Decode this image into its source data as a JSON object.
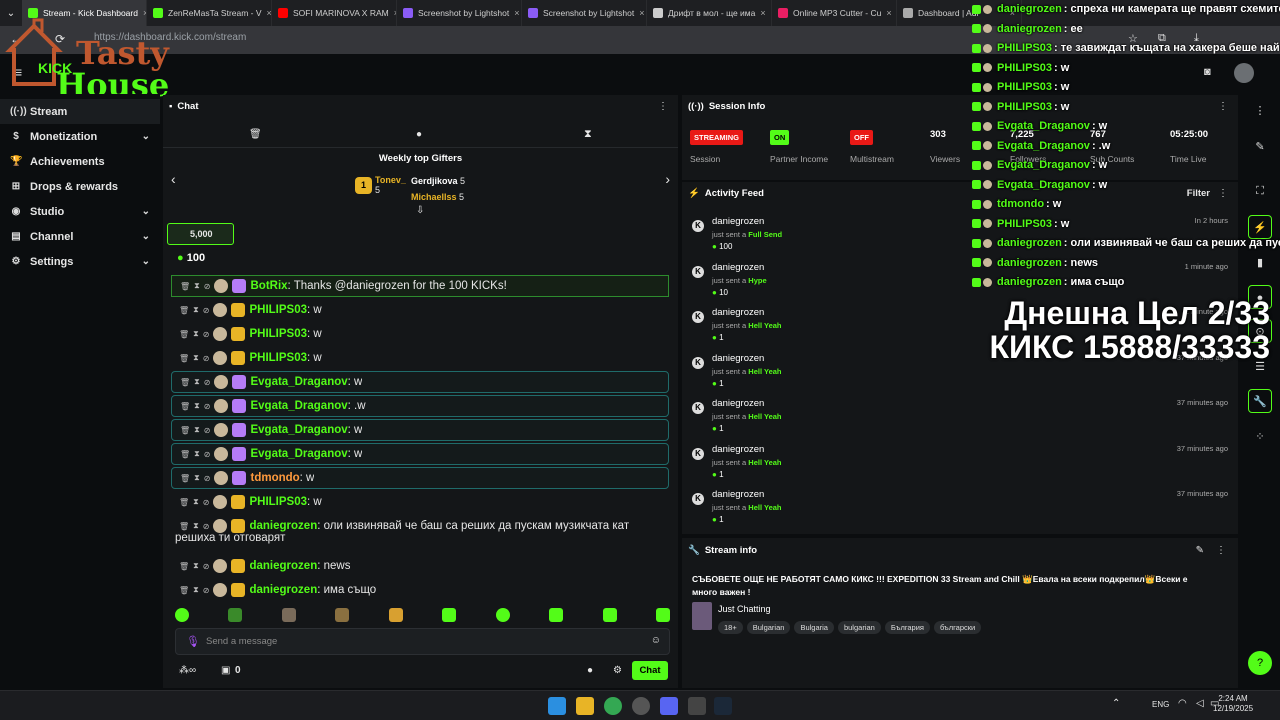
{
  "browser": {
    "tabs": [
      {
        "title": "Stream - Kick Dashboard",
        "color": "#53fc18",
        "active": true
      },
      {
        "title": "ZenReMasTa Stream - V",
        "color": "#53fc18",
        "active": false
      },
      {
        "title": "SOFI MARINOVA X RAM",
        "color": "#ff0000",
        "active": false
      },
      {
        "title": "Screenshot by Lightshot",
        "color": "#8b5cf6",
        "active": false
      },
      {
        "title": "Screenshot by Lightshot",
        "color": "#8b5cf6",
        "active": false
      },
      {
        "title": "Дрифт в мол - ще има",
        "color": "#cccccc",
        "active": false
      },
      {
        "title": "Online MP3 Cutter - Cu",
        "color": "#e91e63",
        "active": false
      },
      {
        "title": "Dashboard | Adi",
        "color": "#aaaaaa",
        "active": false
      }
    ],
    "url": "https://dashboard.kick.com/stream"
  },
  "logo": {
    "line1": "Tasty",
    "line2": "House",
    "brand": "KICK"
  },
  "sidebar": {
    "items": [
      {
        "label": "Stream",
        "icon": "stream-icon",
        "glyph": "((·))",
        "chevron": false,
        "selected": true
      },
      {
        "label": "Monetization",
        "icon": "dollar-icon",
        "glyph": "$",
        "chevron": true,
        "selected": false
      },
      {
        "label": "Achievements",
        "icon": "trophy-icon",
        "glyph": "🏆",
        "chevron": false,
        "selected": false
      },
      {
        "label": "Drops & rewards",
        "icon": "gift-icon",
        "glyph": "⊞",
        "chevron": false,
        "selected": false
      },
      {
        "label": "Studio",
        "icon": "studio-icon",
        "glyph": "◉",
        "chevron": true,
        "selected": false
      },
      {
        "label": "Channel",
        "icon": "channel-icon",
        "glyph": "▤",
        "chevron": true,
        "selected": false
      },
      {
        "label": "Settings",
        "icon": "gear-icon",
        "glyph": "⚙",
        "chevron": true,
        "selected": false
      }
    ]
  },
  "chat": {
    "title": "Chat",
    "gifters_title": "Weekly top Gifters",
    "gifters": [
      {
        "name": "Tonev_",
        "count": "5"
      },
      {
        "name": "Gerdjikova",
        "count": "5"
      },
      {
        "name": "Michaellss",
        "count": "5"
      }
    ],
    "pinned_amount": "5,000",
    "pinned_kicks": "100",
    "messages": [
      {
        "user": "BotRix",
        "text": ": Thanks @daniegrozen for the 100 KICKs!",
        "color": "#53fc18",
        "style": "green"
      },
      {
        "user": "PHILIPS03",
        "text": ": w",
        "color": "#53fc18",
        "style": "plain"
      },
      {
        "user": "PHILIPS03",
        "text": ": w",
        "color": "#53fc18",
        "style": "plain"
      },
      {
        "user": "PHILIPS03",
        "text": ": w",
        "color": "#53fc18",
        "style": "plain"
      },
      {
        "user": "Evgata_Draganov",
        "text": ": w",
        "color": "#53fc18",
        "style": "boxed"
      },
      {
        "user": "Evgata_Draganov",
        "text": ": .w",
        "color": "#53fc18",
        "style": "boxed"
      },
      {
        "user": "Evgata_Draganov",
        "text": ": w",
        "color": "#53fc18",
        "style": "boxed"
      },
      {
        "user": "Evgata_Draganov",
        "text": ": w",
        "color": "#53fc18",
        "style": "boxed"
      },
      {
        "user": "tdmondo",
        "text": ": w",
        "color": "#ff9a3d",
        "style": "boxed"
      },
      {
        "user": "PHILIPS03",
        "text": ": w",
        "color": "#53fc18",
        "style": "plain"
      },
      {
        "user": "daniegrozen",
        "text": ": оли извинявай че баш са реших да пускам музикчата кат",
        "color": "#53fc18",
        "style": "plain"
      },
      {
        "user": "daniegrozen",
        "text": ": news",
        "color": "#53fc18",
        "style": "plain"
      },
      {
        "user": "daniegrozen",
        "text": ": има също",
        "color": "#53fc18",
        "style": "plain"
      }
    ],
    "wrap_line": "решиха ти отговарят",
    "input_placeholder": "Send a message",
    "footer_count": "0",
    "send_label": "Chat"
  },
  "session": {
    "title": "Session Info",
    "status": [
      {
        "badge": "STREAMING",
        "label": "Session",
        "color": "#e91916"
      },
      {
        "badge": "ON",
        "label": "Partner Income",
        "color": "#53fc18"
      },
      {
        "badge": "OFF",
        "label": "Multistream",
        "color": "#e91916"
      }
    ],
    "stats": [
      {
        "value": "303",
        "label": "Viewers"
      },
      {
        "value": "7,225",
        "label": "Followers"
      },
      {
        "value": "767",
        "label": "Sub Counts"
      },
      {
        "value": "05:25:00",
        "label": "Time Live"
      }
    ]
  },
  "activity": {
    "title": "Activity Feed",
    "filter": "Filter",
    "items": [
      {
        "user": "daniegrozen",
        "action": "just sent a",
        "item": "Full Send",
        "amount": "100",
        "time": "In 2 hours"
      },
      {
        "user": "daniegrozen",
        "action": "just sent a",
        "item": "Hype",
        "amount": "10",
        "time": "1 minute ago"
      },
      {
        "user": "daniegrozen",
        "action": "just sent a",
        "item": "Hell Yeah",
        "amount": "1",
        "time": "1 minute ago"
      },
      {
        "user": "daniegrozen",
        "action": "just sent a",
        "item": "Hell Yeah",
        "amount": "1",
        "time": "37 minutes ago"
      },
      {
        "user": "daniegrozen",
        "action": "just sent a",
        "item": "Hell Yeah",
        "amount": "1",
        "time": "37 minutes ago"
      },
      {
        "user": "daniegrozen",
        "action": "just sent a",
        "item": "Hell Yeah",
        "amount": "1",
        "time": "37 minutes ago"
      },
      {
        "user": "daniegrozen",
        "action": "just sent a",
        "item": "Hell Yeah",
        "amount": "1",
        "time": "37 minutes ago"
      }
    ]
  },
  "stream_info": {
    "title": "Stream info",
    "stream_title": "СЪБОВЕТЕ ОЩЕ НЕ РАБОТЯТ САМО КИКС !!! EXPEDITION 33 Stream and Chill 👑Евала на всеки подкрепил👑Всеки е много важен !",
    "category": "Just Chatting",
    "tags": [
      "18+",
      "Bulgarian",
      "Bulgaria",
      "bulgarian",
      "България",
      "български"
    ]
  },
  "overlay": {
    "lines": [
      {
        "user": "daniegrozen",
        "text": ": спреха ни камерата ще правят схемите"
      },
      {
        "user": "daniegrozen",
        "text": ": ее"
      },
      {
        "user": "PHILIPS03",
        "text": ": те завиждат къщата на хакера беше най добр"
      },
      {
        "user": "PHILIPS03",
        "text": ": w"
      },
      {
        "user": "PHILIPS03",
        "text": ": w"
      },
      {
        "user": "PHILIPS03",
        "text": ": w"
      },
      {
        "user": "Evgata_Draganov",
        "text": ": w"
      },
      {
        "user": "Evgata_Draganov",
        "text": ": .w"
      },
      {
        "user": "Evgata_Draganov",
        "text": ": w"
      },
      {
        "user": "Evgata_Draganov",
        "text": ": w"
      },
      {
        "user": "tdmondo",
        "text": ": w"
      },
      {
        "user": "PHILIPS03",
        "text": ": w"
      },
      {
        "user": "daniegrozen",
        "text": ": оли извинявай че баш са реших да пускам"
      },
      {
        "user": "daniegrozen",
        "text": ": news"
      },
      {
        "user": "daniegrozen",
        "text": ": има също"
      }
    ],
    "goal_line1": "Днешна Цел 2/33",
    "goal_line2": "КИКС 15888/33333"
  },
  "taskbar": {
    "time": "2:24 AM",
    "date": "12/19/2025",
    "lang": "ENG"
  },
  "colors": {
    "accent": "#53fc18",
    "bg": "#0b0d0f",
    "panel": "#141618",
    "danger": "#e91916"
  }
}
